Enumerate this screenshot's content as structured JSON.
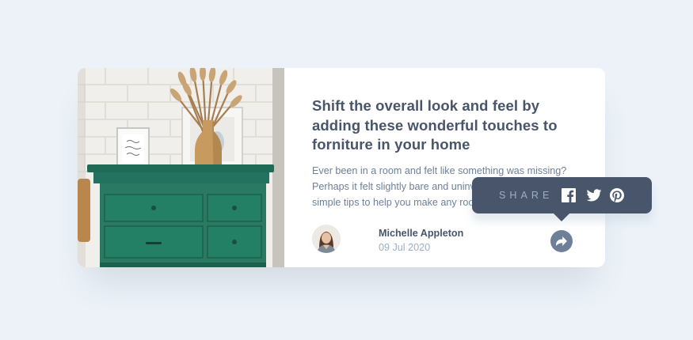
{
  "card": {
    "title": "Shift the overall look and feel by adding these wonderful touches to forniture in your home",
    "excerpt": "Ever been in a room and felt like something was missing? Perhaps it felt slightly bare and uninviting. I've got some simple tips to help you make any room feel complete.",
    "image": "drawers-photo",
    "author": {
      "name": "Michelle Appleton",
      "date": "09 Jul 2020",
      "avatar": "avatar-michelle"
    }
  },
  "share": {
    "label": "SHARE",
    "button_icon": "share-icon",
    "networks": [
      {
        "name": "facebook",
        "icon": "facebook-icon"
      },
      {
        "name": "twitter",
        "icon": "twitter-icon"
      },
      {
        "name": "pinterest",
        "icon": "pinterest-icon"
      }
    ]
  },
  "colors": {
    "page_background": "#ecf2f8",
    "card_background": "#ffffff",
    "title": "#48556a",
    "body_text": "#6e8098",
    "muted": "#9eafc2",
    "tooltip_background": "#48556a",
    "drawer_green": "#2a7a62"
  }
}
